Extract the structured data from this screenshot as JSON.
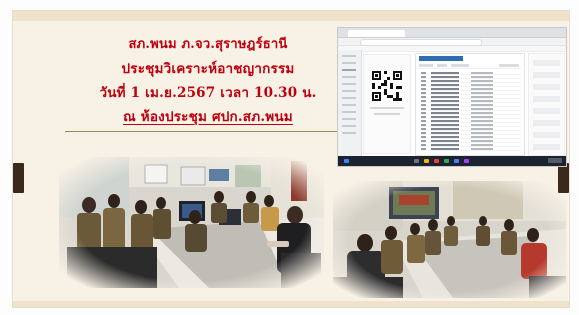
{
  "slide": {
    "title_lines": [
      "สภ.พนม  ภ.จว.สุราษฎร์ธานี",
      "ประชุมวิเคราะห์อาชญากรรม",
      "วันที่ 1 เม.ย.2567 เวลา 10.30 น.",
      "ณ ห้องประชุม ศปก.สภ.พนม"
    ],
    "colors": {
      "title": "#c0000c",
      "slide_background": "#f7f1e6",
      "side_tabs": "#3b2a1c",
      "divider": "#8c8f56"
    }
  },
  "screenshot_inset": {
    "description_icon": "browser-window",
    "list_header_color": "#2f6db3"
  },
  "photos": [
    {
      "icon": "meeting-room-photo-left"
    },
    {
      "icon": "meeting-room-photo-right"
    }
  ]
}
